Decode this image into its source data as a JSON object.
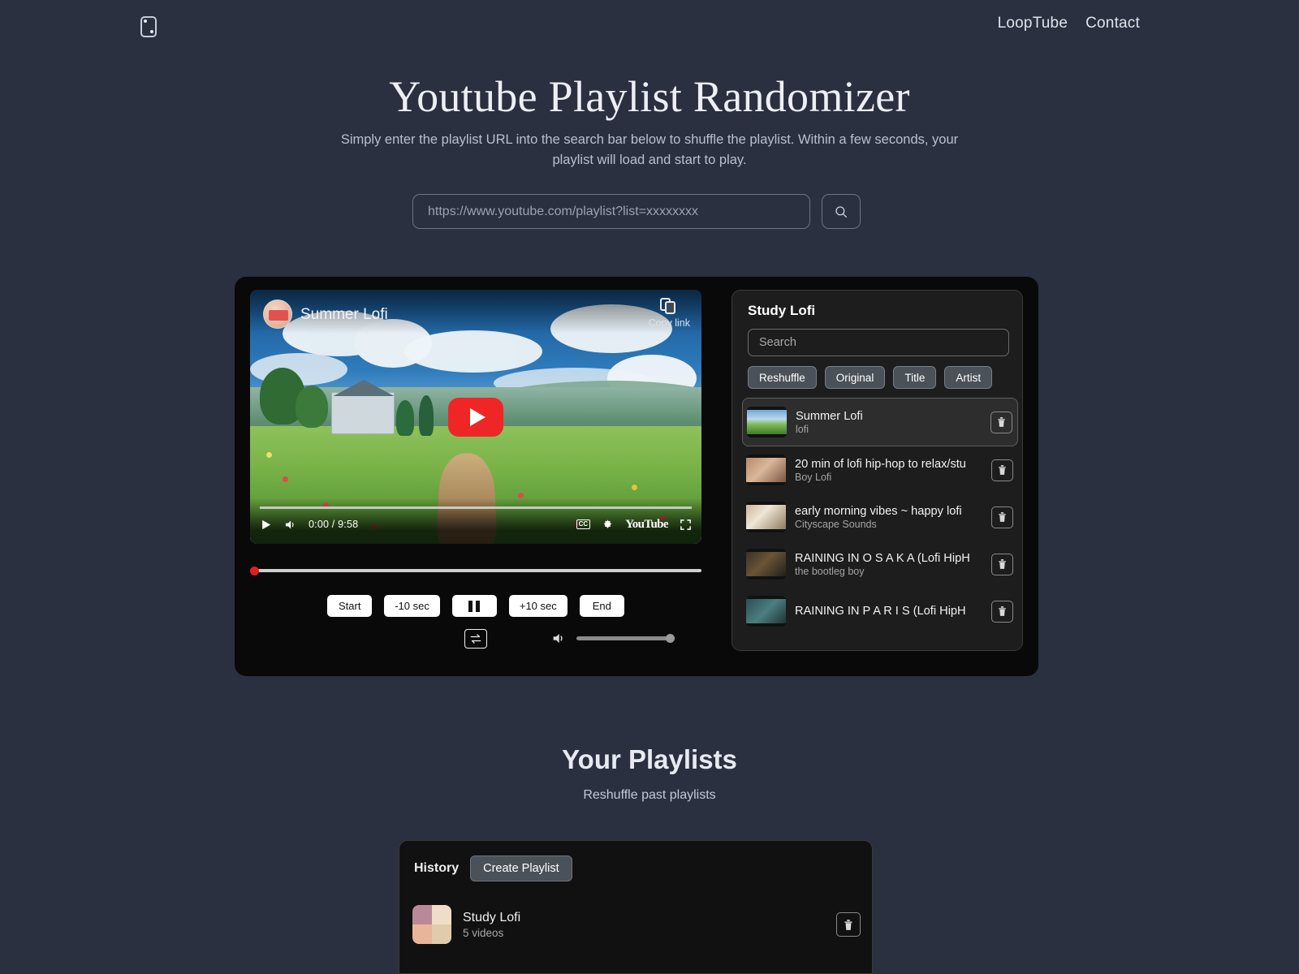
{
  "header": {
    "logo_icon": "dice-icon",
    "nav": [
      {
        "label": "LoopTube"
      },
      {
        "label": "Contact"
      }
    ]
  },
  "hero": {
    "title": "Youtube Playlist Randomizer",
    "subtitle": "Simply enter the playlist URL into the search bar below to shuffle the playlist. Within a few seconds, your playlist will load and start to play."
  },
  "search": {
    "placeholder": "https://www.youtube.com/playlist?list=xxxxxxxx",
    "value": "",
    "button_icon": "search-icon"
  },
  "player": {
    "video_title": "Summer Lofi",
    "copy_link_label": "Copy link",
    "time_display": "0:00 / 9:58",
    "youtube_label": "YouTube",
    "cc_label": "CC",
    "buttons": [
      {
        "label": "Start",
        "name": "start-button"
      },
      {
        "label": "-10 sec",
        "name": "back-10-button"
      },
      {
        "label": "",
        "name": "pause-button"
      },
      {
        "label": "+10 sec",
        "name": "forward-10-button"
      },
      {
        "label": "End",
        "name": "end-button"
      }
    ],
    "loop_icon": "loop-icon",
    "volume_icon": "volume-icon",
    "volume_percent": 100,
    "progress_percent": 0
  },
  "playlist": {
    "title": "Study Lofi",
    "search_placeholder": "Search",
    "search_value": "",
    "chips": [
      {
        "label": "Reshuffle"
      },
      {
        "label": "Original"
      },
      {
        "label": "Title"
      },
      {
        "label": "Artist"
      }
    ],
    "items": [
      {
        "title": "Summer Lofi",
        "artist": "lofi",
        "active": true
      },
      {
        "title": "20 min of lofi hip-hop to relax/stu",
        "artist": "Boy Lofi",
        "active": false
      },
      {
        "title": "early morning vibes ~ happy lofi",
        "artist": "Cityscape Sounds",
        "active": false
      },
      {
        "title": "RAINING IN O S A K A  (Lofi HipH",
        "artist": "the bootleg boy",
        "active": false
      },
      {
        "title": "RAINING IN P A R I S  (Lofi HipH",
        "artist": "",
        "active": false
      }
    ]
  },
  "your_playlists": {
    "title": "Your Playlists",
    "subtitle": "Reshuffle past playlists",
    "tab_label": "History",
    "create_label": "Create Playlist",
    "rows": [
      {
        "name": "Study Lofi",
        "count": "5 videos"
      }
    ]
  },
  "colors": {
    "page_bg": "#2a3040",
    "card_bg": "#090909",
    "panel_bg": "#1d1d1d",
    "accent_red": "#ef2626",
    "chip_bg": "#4b5158"
  }
}
